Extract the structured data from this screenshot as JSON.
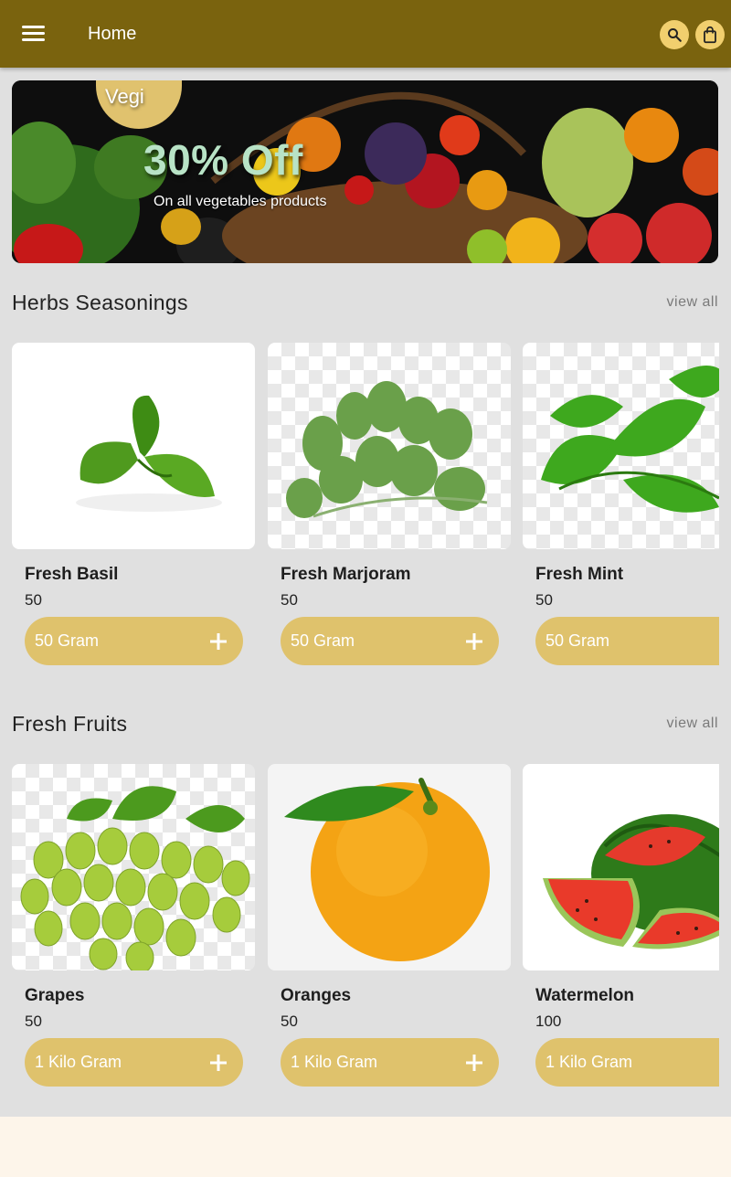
{
  "appbar": {
    "title": "Home",
    "menu_icon": "hamburger-menu-icon",
    "search_icon": "search-icon",
    "bag_icon": "shopping-bag-icon",
    "color": "#7a630e",
    "button_color": "#f1cf6e"
  },
  "banner": {
    "tag": "Vegi",
    "title": "30% Off",
    "subtitle": "On all vegetables products"
  },
  "sections": [
    {
      "title": "Herbs Seasonings",
      "view_all": "view all",
      "items": [
        {
          "name": "Fresh Basil",
          "price": "50",
          "unit": "50 Gram",
          "image": "basil-image"
        },
        {
          "name": "Fresh Marjoram",
          "price": "50",
          "unit": "50 Gram",
          "image": "marjoram-image"
        },
        {
          "name": "Fresh Mint",
          "price": "50",
          "unit": "50 Gram",
          "image": "mint-image"
        }
      ]
    },
    {
      "title": "Fresh Fruits",
      "view_all": "view all",
      "items": [
        {
          "name": "Grapes",
          "price": "50",
          "unit": "1 Kilo Gram",
          "image": "grapes-image"
        },
        {
          "name": "Oranges",
          "price": "50",
          "unit": "1 Kilo Gram",
          "image": "orange-image"
        },
        {
          "name": "Watermelon",
          "price": "100",
          "unit": "1 Kilo Gram",
          "image": "watermelon-image"
        }
      ]
    }
  ],
  "colors": {
    "accent": "#dfc26c",
    "background": "#e0e0e0"
  }
}
